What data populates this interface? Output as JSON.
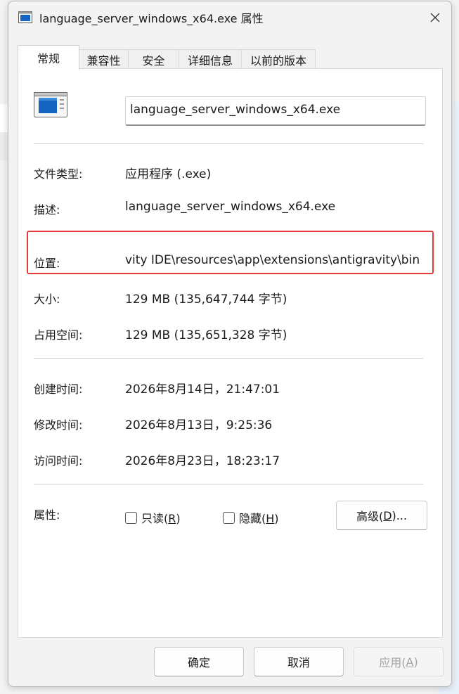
{
  "window": {
    "title": "language_server_windows_x64.exe 属性"
  },
  "tabs": [
    {
      "label": "常规",
      "active": true
    },
    {
      "label": "兼容性",
      "active": false
    },
    {
      "label": "安全",
      "active": false
    },
    {
      "label": "详细信息",
      "active": false
    },
    {
      "label": "以前的版本",
      "active": false
    }
  ],
  "general": {
    "filename": "language_server_windows_x64.exe",
    "file_type_label": "文件类型:",
    "file_type_value": "应用程序 (.exe)",
    "description_label": "描述:",
    "description_value": "language_server_windows_x64.exe",
    "location_label": "位置:",
    "location_value": "vity IDE\\resources\\app\\extensions\\antigravity\\bin",
    "size_label": "大小:",
    "size_value": "129 MB (135,647,744 字节)",
    "size_on_disk_label": "占用空间:",
    "size_on_disk_value": "129 MB (135,651,328 字节)",
    "created_label": "创建时间:",
    "created_value": "2026年8月14日，21:47:01",
    "modified_label": "修改时间:",
    "modified_value": "2026年8月13日，9:25:36",
    "accessed_label": "访问时间:",
    "accessed_value": "2026年8月23日，18:23:17",
    "attributes_label": "属性:",
    "readonly": {
      "text": "只读(",
      "key": "R",
      "suffix": ")",
      "checked": false
    },
    "hidden": {
      "text": "隐藏(",
      "key": "H",
      "suffix": ")",
      "checked": false
    },
    "advanced": {
      "text": "高级(",
      "key": "D",
      "suffix": ")..."
    }
  },
  "buttons": {
    "ok": "确定",
    "cancel": "取消",
    "apply": {
      "text": "应用(",
      "key": "A",
      "suffix": ")",
      "enabled": false
    }
  },
  "colors": {
    "highlight_border": "#e53b3b",
    "icon_blue": "#1565c0"
  }
}
